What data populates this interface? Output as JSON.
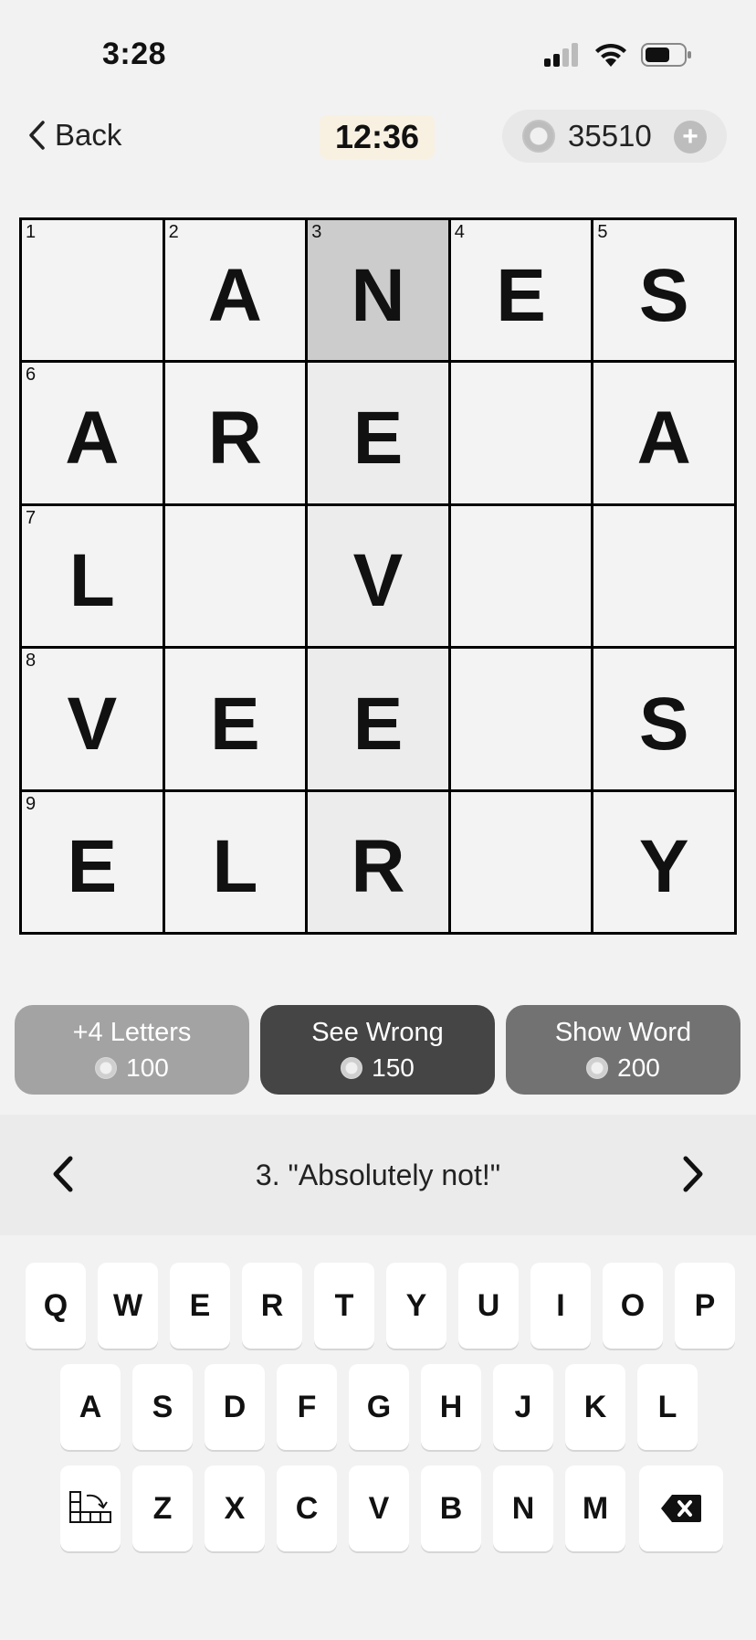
{
  "status": {
    "time": "3:28"
  },
  "header": {
    "back_label": "Back",
    "timer": "12:36",
    "coins": "35510",
    "plus": "+"
  },
  "grid": {
    "rows": [
      [
        {
          "num": "1",
          "letter": "",
          "state": ""
        },
        {
          "num": "2",
          "letter": "A",
          "state": ""
        },
        {
          "num": "3",
          "letter": "N",
          "state": "active"
        },
        {
          "num": "4",
          "letter": "E",
          "state": ""
        },
        {
          "num": "5",
          "letter": "S",
          "state": ""
        }
      ],
      [
        {
          "num": "6",
          "letter": "A",
          "state": ""
        },
        {
          "num": "",
          "letter": "R",
          "state": ""
        },
        {
          "num": "",
          "letter": "E",
          "state": "word"
        },
        {
          "num": "",
          "letter": "",
          "state": ""
        },
        {
          "num": "",
          "letter": "A",
          "state": ""
        }
      ],
      [
        {
          "num": "7",
          "letter": "L",
          "state": ""
        },
        {
          "num": "",
          "letter": "",
          "state": ""
        },
        {
          "num": "",
          "letter": "V",
          "state": "word"
        },
        {
          "num": "",
          "letter": "",
          "state": ""
        },
        {
          "num": "",
          "letter": "",
          "state": ""
        }
      ],
      [
        {
          "num": "8",
          "letter": "V",
          "state": ""
        },
        {
          "num": "",
          "letter": "E",
          "state": ""
        },
        {
          "num": "",
          "letter": "E",
          "state": "word"
        },
        {
          "num": "",
          "letter": "",
          "state": ""
        },
        {
          "num": "",
          "letter": "S",
          "state": ""
        }
      ],
      [
        {
          "num": "9",
          "letter": "E",
          "state": ""
        },
        {
          "num": "",
          "letter": "L",
          "state": ""
        },
        {
          "num": "",
          "letter": "R",
          "state": "word"
        },
        {
          "num": "",
          "letter": "",
          "state": ""
        },
        {
          "num": "",
          "letter": "Y",
          "state": ""
        }
      ]
    ]
  },
  "hints": [
    {
      "label": "+4 Letters",
      "cost": "100"
    },
    {
      "label": "See Wrong",
      "cost": "150"
    },
    {
      "label": "Show Word",
      "cost": "200"
    }
  ],
  "clue": {
    "text": "3. \"Absolutely not!\""
  },
  "keyboard": {
    "row1": [
      "Q",
      "W",
      "E",
      "R",
      "T",
      "Y",
      "U",
      "I",
      "O",
      "P"
    ],
    "row2": [
      "A",
      "S",
      "D",
      "F",
      "G",
      "H",
      "J",
      "K",
      "L"
    ],
    "row3": [
      "Z",
      "X",
      "C",
      "V",
      "B",
      "N",
      "M"
    ]
  },
  "colors": {
    "active_cell": "#cccccc",
    "word_cell": "#ececec",
    "timer_bg": "#f8f1e2"
  }
}
